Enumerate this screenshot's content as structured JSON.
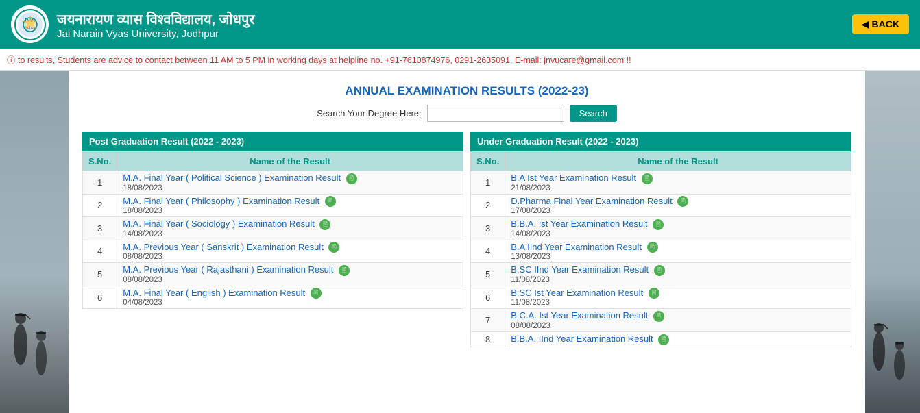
{
  "header": {
    "hindi_title": "जयनारायण व्यास विश्वविद्यालय, जोधपुर",
    "english_title": "Jai Narain Vyas University, Jodhpur",
    "back_label": "◀ BACK"
  },
  "ticker": {
    "text": "ⓘ to results, Students are advice to contact between 11 AM to 5 PM in working days at helpline no. +91-7610874976, 0291-2635091, E-mail: jnvucare@gmail.com !!"
  },
  "page_title": "ANNUAL EXAMINATION RESULTS (2022-23)",
  "search": {
    "label": "Search Your Degree Here:",
    "placeholder": "",
    "button": "Search"
  },
  "pg_section": {
    "header": "Post Graduation Result (2022 - 2023)",
    "col_sno": "S.No.",
    "col_name": "Name of the Result",
    "rows": [
      {
        "sno": "1",
        "name": "M.A. Final Year ( Political Science ) Examination Result",
        "date": "18/08/2023"
      },
      {
        "sno": "2",
        "name": "M.A. Final Year ( Philosophy ) Examination Result",
        "date": "18/08/2023"
      },
      {
        "sno": "3",
        "name": "M.A. Final Year ( Sociology ) Examination Result",
        "date": "14/08/2023"
      },
      {
        "sno": "4",
        "name": "M.A. Previous Year ( Sanskrit ) Examination Result",
        "date": "08/08/2023"
      },
      {
        "sno": "5",
        "name": "M.A. Previous Year ( Rajasthani ) Examination Result",
        "date": "08/08/2023"
      },
      {
        "sno": "6",
        "name": "M.A. Final Year ( English ) Examination Result",
        "date": "04/08/2023"
      }
    ]
  },
  "ug_section": {
    "header": "Under Graduation Result (2022 - 2023)",
    "col_sno": "S.No.",
    "col_name": "Name of the Result",
    "rows": [
      {
        "sno": "1",
        "name": "B.A Ist Year Examination Result",
        "date": "21/08/2023"
      },
      {
        "sno": "2",
        "name": "D.Pharma Final Year Examination Result",
        "date": "17/08/2023"
      },
      {
        "sno": "3",
        "name": "B.B.A. Ist Year Examination Result",
        "date": "14/08/2023"
      },
      {
        "sno": "4",
        "name": "B.A IInd Year Examination Result",
        "date": "13/08/2023"
      },
      {
        "sno": "5",
        "name": "B.SC IInd Year Examination Result",
        "date": "11/08/2023"
      },
      {
        "sno": "6",
        "name": "B.SC Ist Year Examination Result",
        "date": "11/08/2023"
      },
      {
        "sno": "7",
        "name": "B.C.A. Ist Year Examination Result",
        "date": "08/08/2023"
      },
      {
        "sno": "8",
        "name": "B.B.A. IInd Year Examination Result",
        "date": ""
      }
    ]
  }
}
